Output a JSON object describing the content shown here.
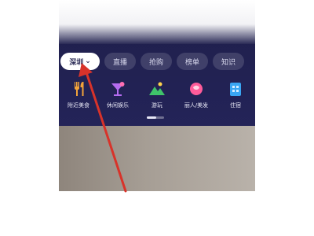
{
  "filters": [
    {
      "label": "深圳",
      "chevron": "⌄",
      "active": true
    },
    {
      "label": "直播",
      "active": false
    },
    {
      "label": "抢购",
      "active": false
    },
    {
      "label": "榜单",
      "active": false
    },
    {
      "label": "知识",
      "active": false
    }
  ],
  "categories": [
    {
      "label": "附近美食",
      "icon": "fork-knife-icon"
    },
    {
      "label": "休闲娱乐",
      "icon": "cocktail-icon"
    },
    {
      "label": "游玩",
      "icon": "mountain-icon"
    },
    {
      "label": "丽人/美发",
      "icon": "beauty-icon"
    },
    {
      "label": "住宿",
      "icon": "hotel-icon"
    }
  ],
  "colors": {
    "screen_bg": "#232357",
    "active_pill": "#ffffff",
    "annotation_arrow": "#d8332a"
  }
}
